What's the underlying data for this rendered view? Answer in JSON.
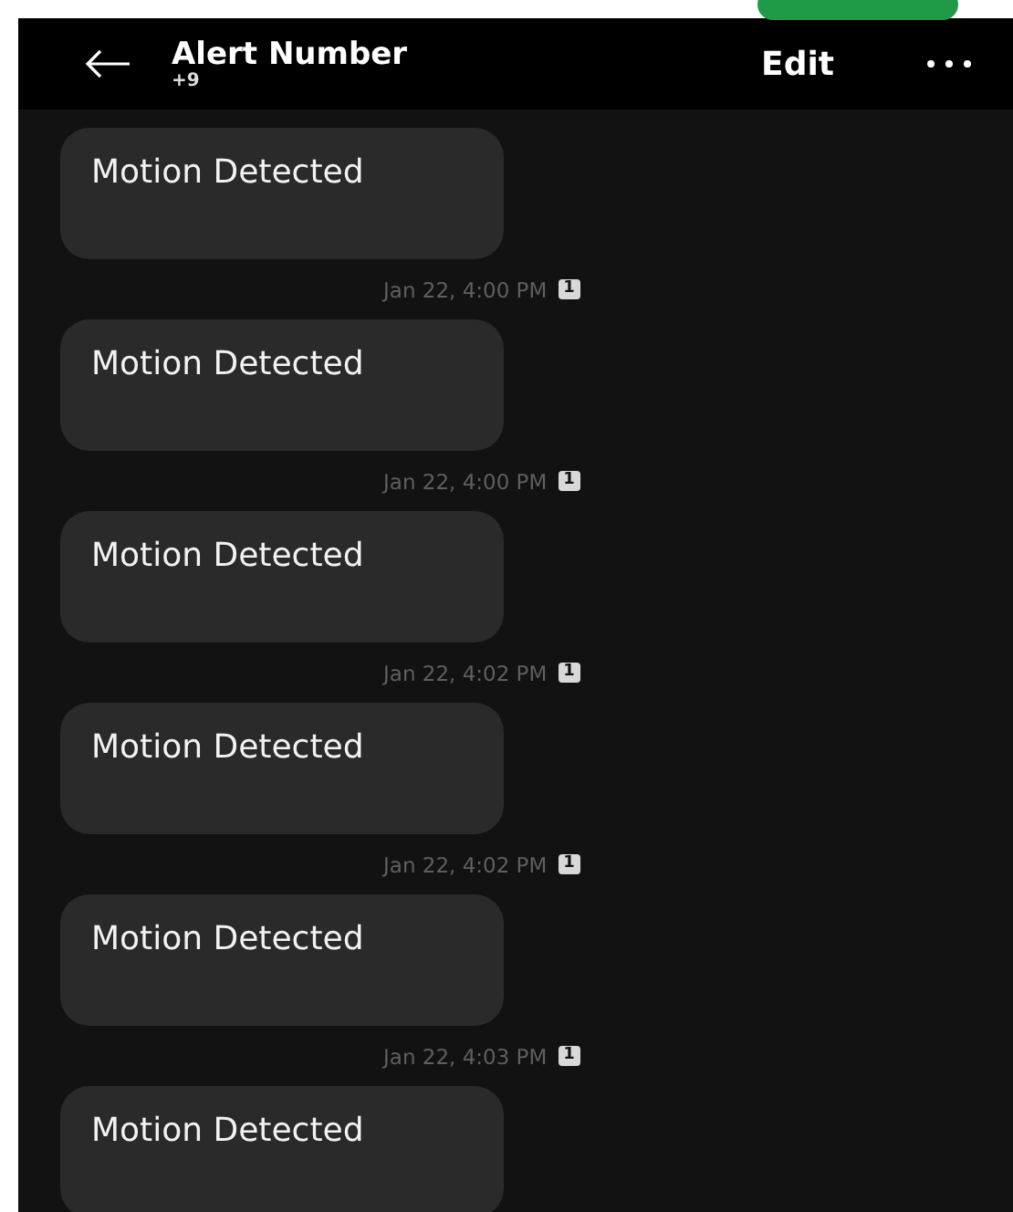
{
  "header": {
    "title": "Alert Number",
    "subtitle": "+9",
    "edit": "Edit"
  },
  "messages": [
    {
      "text": "Motion Detected",
      "time": "Jan 22, 4:00 PM",
      "sim": "1"
    },
    {
      "text": "Motion Detected",
      "time": "Jan 22, 4:00 PM",
      "sim": "1"
    },
    {
      "text": "Motion Detected",
      "time": "Jan 22, 4:02 PM",
      "sim": "1"
    },
    {
      "text": "Motion Detected",
      "time": "Jan 22, 4:02 PM",
      "sim": "1"
    },
    {
      "text": "Motion Detected",
      "time": "Jan 22, 4:03 PM",
      "sim": "1"
    },
    {
      "text": "Motion Detected"
    }
  ]
}
